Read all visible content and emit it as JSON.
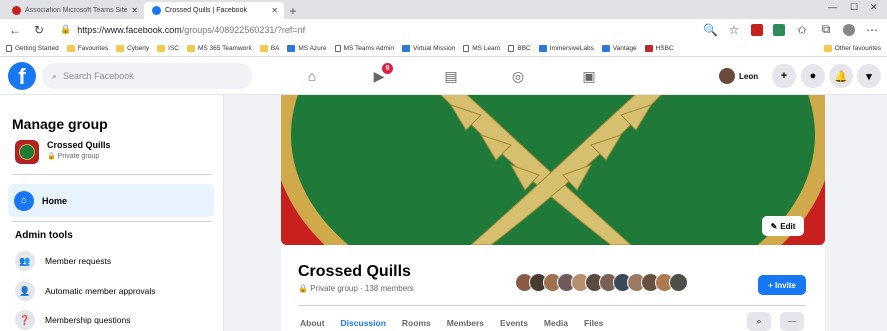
{
  "browser": {
    "tabs": [
      {
        "title": "Association Microsoft Teams Site",
        "active": false,
        "icon_color": "#c8201f"
      },
      {
        "title": "Crossed Quills | Facebook",
        "active": true,
        "icon_color": "#1877f2"
      }
    ],
    "url_host": "https://www.facebook.com",
    "url_path": "/groups/408922560231/?ref=nf",
    "bookmarks": [
      {
        "label": "Getting Started",
        "icon": "page"
      },
      {
        "label": "Favourites",
        "icon": "folder"
      },
      {
        "label": "Cyberly",
        "icon": "folder"
      },
      {
        "label": "ISC",
        "icon": "folder"
      },
      {
        "label": "MS 365 Teamwork",
        "icon": "folder"
      },
      {
        "label": "BA",
        "icon": "folder"
      },
      {
        "label": "MS Azure",
        "icon": "blue"
      },
      {
        "label": "MS Teams Admin",
        "icon": "page"
      },
      {
        "label": "Virtual Mission",
        "icon": "blue"
      },
      {
        "label": "MS Learn",
        "icon": "page"
      },
      {
        "label": "BBC",
        "icon": "page"
      },
      {
        "label": "ImmersiveLabs",
        "icon": "blue"
      },
      {
        "label": "Vantage",
        "icon": "blue"
      },
      {
        "label": "HSBC",
        "icon": "red"
      }
    ],
    "other_favourites": "Other favourites"
  },
  "fb": {
    "search_placeholder": "Search Facebook",
    "notif_count": "9",
    "user_name": "Leon"
  },
  "sidebar": {
    "title": "Manage group",
    "group_name": "Crossed Quills",
    "group_privacy": "Private group",
    "home_label": "Home",
    "admin_tools_label": "Admin tools",
    "items": [
      {
        "label": "Member requests"
      },
      {
        "label": "Automatic member approvals"
      },
      {
        "label": "Membership questions"
      }
    ]
  },
  "group": {
    "title": "Crossed Quills",
    "meta": "Private group · 138 members",
    "edit_label": "Edit",
    "invite_label": "+ Invite",
    "tabs": [
      "About",
      "Discussion",
      "Rooms",
      "Members",
      "Events",
      "Media",
      "Files"
    ],
    "active_tab": "Discussion"
  },
  "colors": {
    "brand": "#1877f2",
    "cover_red": "#c8201f",
    "cover_green": "#1f7a3a",
    "quill_gold": "#d6c070"
  }
}
